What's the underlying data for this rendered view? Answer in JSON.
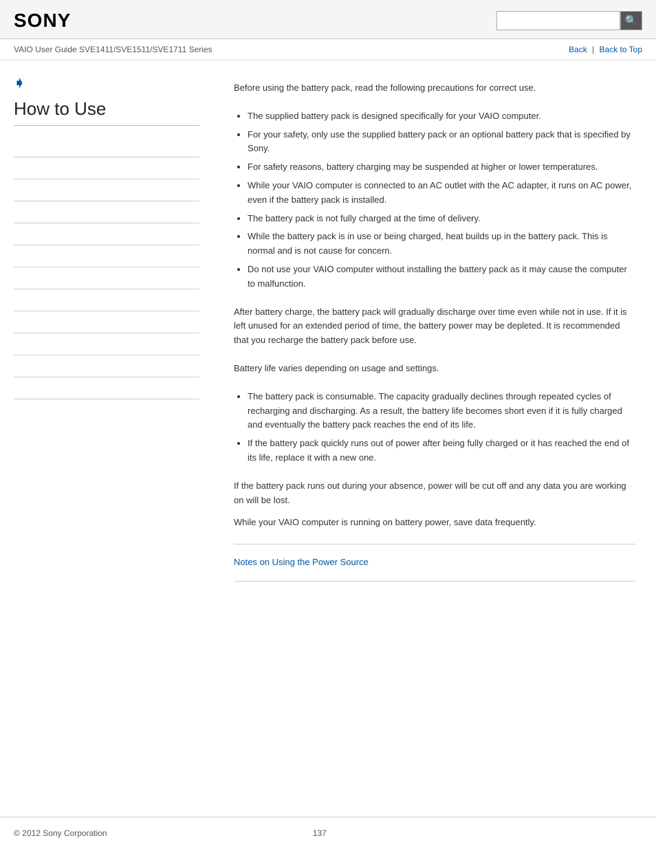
{
  "header": {
    "logo": "SONY",
    "search_placeholder": ""
  },
  "nav": {
    "title": "VAIO User Guide SVE1411/SVE1511/SVE1711 Series",
    "back_label": "Back",
    "back_to_top_label": "Back to Top",
    "divider": "|"
  },
  "sidebar": {
    "chevron": "❯",
    "section_title": "How to Use",
    "links": [
      {
        "label": ""
      },
      {
        "label": ""
      },
      {
        "label": ""
      },
      {
        "label": ""
      },
      {
        "label": ""
      },
      {
        "label": ""
      },
      {
        "label": ""
      },
      {
        "label": ""
      },
      {
        "label": ""
      },
      {
        "label": ""
      },
      {
        "label": ""
      },
      {
        "label": ""
      }
    ]
  },
  "content": {
    "intro": "Before using the battery pack, read the following precautions for correct use.",
    "bullets1": [
      "The supplied battery pack is designed specifically for your VAIO computer.",
      "For your safety, only use the supplied battery pack or an optional battery pack that is specified by Sony.",
      "For safety reasons, battery charging may be suspended at higher or lower temperatures.",
      "While your VAIO computer is connected to an AC outlet with the AC adapter, it runs on AC power, even if the battery pack is installed.",
      "The battery pack is not fully charged at the time of delivery.",
      "While the battery pack is in use or being charged, heat builds up in the battery pack. This is normal and is not cause for concern.",
      "Do not use your VAIO computer without installing the battery pack as it may cause the computer to malfunction."
    ],
    "para2": "After battery charge, the battery pack will gradually discharge over time even while not in use. If it is left unused for an extended period of time, the battery power may be depleted. It is recommended that you recharge the battery pack before use.",
    "para3": "Battery life varies depending on usage and settings.",
    "bullets2": [
      "The battery pack is consumable. The capacity gradually declines through repeated cycles of recharging and discharging. As a result, the battery life becomes short even if it is fully charged and eventually the battery pack reaches the end of its life.",
      "If the battery pack quickly runs out of power after being fully charged or it has reached the end of its life, replace it with a new one."
    ],
    "para4a": "If the battery pack runs out during your absence, power will be cut off and any data you are working on will be lost.",
    "para4b": "While your VAIO computer is running on battery power, save data frequently.",
    "related_link": "Notes on Using the Power Source"
  },
  "footer": {
    "copyright": "© 2012 Sony Corporation",
    "page_number": "137"
  },
  "icons": {
    "search": "🔍",
    "chevron": "❯"
  }
}
